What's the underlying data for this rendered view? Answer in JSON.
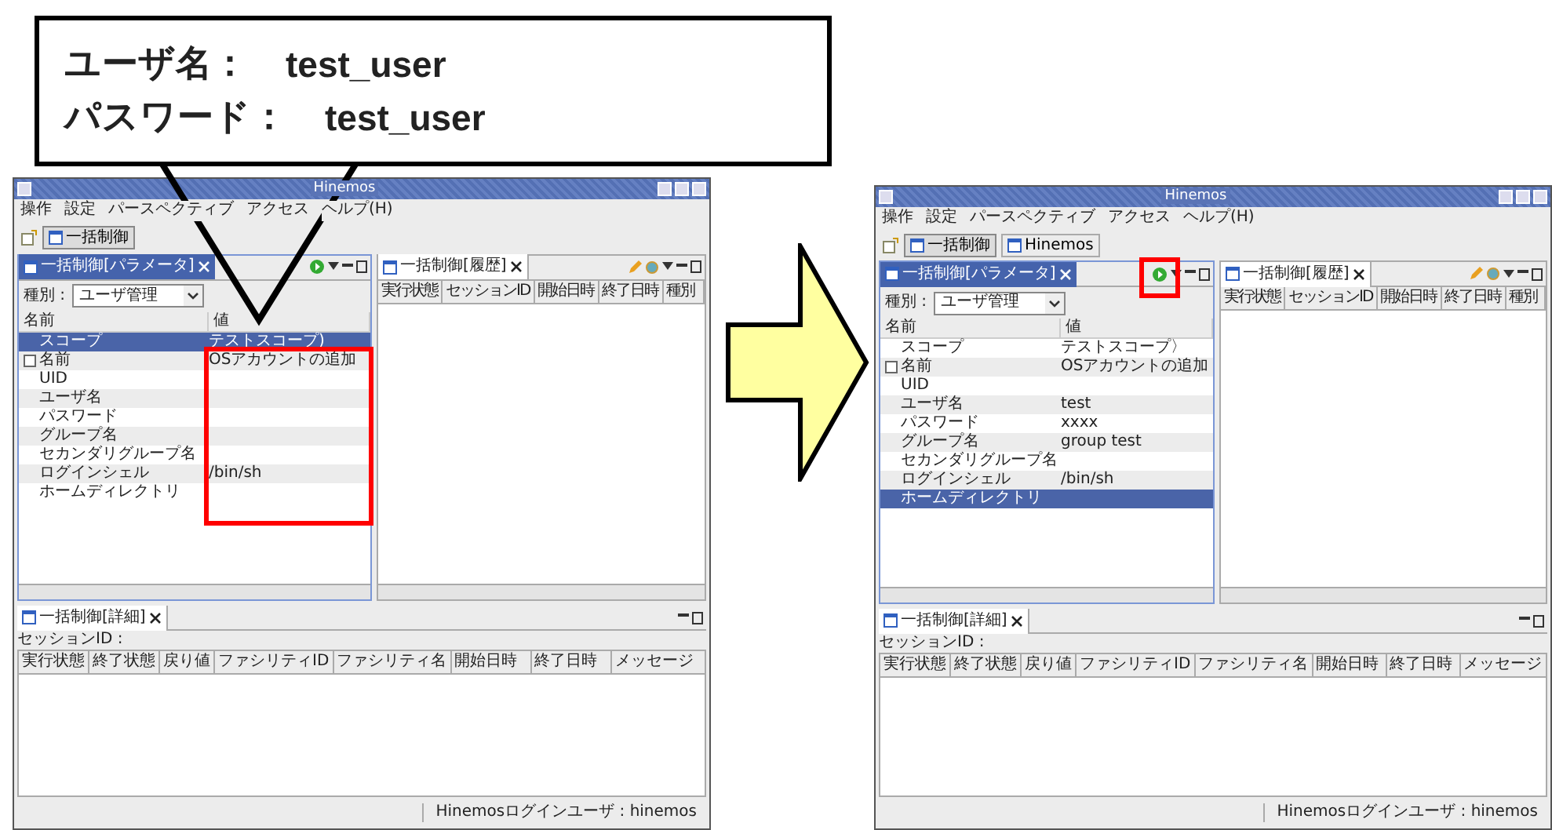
{
  "callout": {
    "lines": [
      {
        "label": "ユーザ名：",
        "value": "test_user"
      },
      {
        "label": "パスワード：",
        "value": "test_user"
      }
    ]
  },
  "windows": [
    {
      "title": "Hinemos",
      "menu": [
        "操作",
        "設定",
        "パースペクティブ",
        "アクセス",
        "ヘルプ(H)"
      ],
      "perspectives": [
        {
          "label": "一括制御",
          "selected": true
        }
      ],
      "parameter_view": {
        "tab": "一括制御[パラメータ]",
        "values_highlighted": true,
        "type_label": "種別 :",
        "type_value": "ユーザ管理",
        "columns": [
          "名前",
          "値"
        ],
        "rows": [
          {
            "name": "スコープ",
            "value": "テストスコープ)",
            "selected": true
          },
          {
            "name": "名前",
            "value": "OSアカウントの追加",
            "selected": false,
            "expander": true
          },
          {
            "name": "UID",
            "selected": false
          },
          {
            "name": "ユーザ名",
            "selected": false
          },
          {
            "name": "パスワード",
            "selected": false
          },
          {
            "name": "グループ名",
            "selected": false
          },
          {
            "name": "セカンダリグループ名",
            "selected": false
          },
          {
            "name": "ログインシェル",
            "value": "/bin/sh",
            "selected": false
          },
          {
            "name": "ホームディレクトリ",
            "selected": false
          }
        ]
      },
      "history_view": {
        "tab": "一括制御[履歴]",
        "columns": [
          "実行状態",
          "セッションID",
          "開始日時",
          "終了日時",
          "種別"
        ]
      },
      "detail_view": {
        "tab": "一括制御[詳細]",
        "session_label": "セッションID :",
        "columns": [
          "実行状態",
          "終了状態",
          "戻り値",
          "ファシリティID",
          "ファシリティ名",
          "開始日時",
          "終了日時",
          "メッセージ"
        ]
      },
      "status": "Hinemosログインユーザ : hinemos"
    },
    {
      "title": "Hinemos",
      "menu": [
        "操作",
        "設定",
        "パースペクティブ",
        "アクセス",
        "ヘルプ(H)"
      ],
      "perspectives": [
        {
          "label": "一括制御",
          "selected": true
        },
        {
          "label": "Hinemos",
          "selected": false
        }
      ],
      "parameter_view": {
        "tab": "一括制御[パラメータ]",
        "run_highlighted": true,
        "type_label": "種別 :",
        "type_value": "ユーザ管理",
        "columns": [
          "名前",
          "値"
        ],
        "rows": [
          {
            "name": "スコープ",
            "value": "テストスコープ〉",
            "selected": false
          },
          {
            "name": "名前",
            "value": "OSアカウントの追加",
            "selected": false,
            "expander": true
          },
          {
            "name": "UID",
            "selected": false
          },
          {
            "name": "ユーザ名",
            "value": "test",
            "selected": false
          },
          {
            "name": "パスワード",
            "value": "xxxx",
            "selected": false
          },
          {
            "name": "グループ名",
            "value": "group test",
            "selected": false
          },
          {
            "name": "セカンダリグループ名",
            "selected": false
          },
          {
            "name": "ログインシェル",
            "value": "/bin/sh",
            "selected": false
          },
          {
            "name": "ホームディレクトリ",
            "selected": true
          }
        ]
      },
      "history_view": {
        "tab": "一括制御[履歴]",
        "columns": [
          "実行状態",
          "セッションID",
          "開始日時",
          "終了日時",
          "種別"
        ]
      },
      "detail_view": {
        "tab": "一括制御[詳細]",
        "session_label": "セッションID :",
        "columns": [
          "実行状態",
          "終了状態",
          "戻り値",
          "ファシリティID",
          "ファシリティ名",
          "開始日時",
          "終了日時",
          "メッセージ"
        ]
      },
      "status": "Hinemosログインユーザ : hinemos"
    }
  ]
}
